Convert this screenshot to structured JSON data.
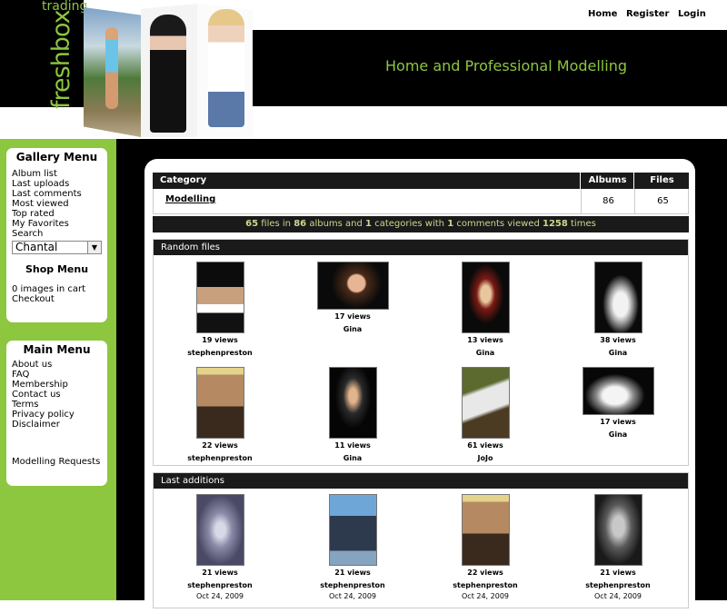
{
  "header": {
    "logo_small": "trading",
    "logo_big": "freshbox",
    "slogan": "Home and Professional Modelling",
    "links": [
      "Home",
      "Register",
      "Login"
    ]
  },
  "gallery_menu": {
    "title": "Gallery Menu",
    "items": [
      "Album list",
      "Last uploads",
      "Last comments",
      "Most viewed",
      "Top rated",
      "My Favorites",
      "Search"
    ],
    "select_value": "Chantal",
    "shop_title": "Shop Menu",
    "shop_items": [
      "0 images in cart",
      "Checkout"
    ]
  },
  "main_menu": {
    "title": "Main Menu",
    "items": [
      "About us",
      "FAQ",
      "Membership",
      "Contact us",
      "Terms",
      "Privacy policy",
      "Disclaimer"
    ],
    "extra": "Modelling Requests"
  },
  "category_table": {
    "headers": [
      "Category",
      "Albums",
      "Files"
    ],
    "row": {
      "name": "Modelling",
      "albums": "86",
      "files": "65"
    },
    "stats": {
      "files": "65",
      "t1": "files in",
      "albums": "86",
      "t2": "albums and",
      "cats": "1",
      "t3": "categories with",
      "comments": "1",
      "t4": "comments viewed",
      "views": "1258",
      "t5": "times"
    }
  },
  "random_files": {
    "title": "Random files",
    "items": [
      {
        "views": "19 views",
        "user": "stephenpreston"
      },
      {
        "views": "17 views",
        "user": "Gina"
      },
      {
        "views": "13 views",
        "user": "Gina"
      },
      {
        "views": "38 views",
        "user": "Gina"
      },
      {
        "views": "22 views",
        "user": "stephenpreston"
      },
      {
        "views": "11 views",
        "user": "Gina"
      },
      {
        "views": "61 views",
        "user": "JoJo"
      },
      {
        "views": "17 views",
        "user": "Gina"
      }
    ]
  },
  "last_additions": {
    "title": "Last additions",
    "items": [
      {
        "views": "21 views",
        "user": "stephenpreston",
        "date": "Oct 24, 2009"
      },
      {
        "views": "21 views",
        "user": "stephenpreston",
        "date": "Oct 24, 2009"
      },
      {
        "views": "22 views",
        "user": "stephenpreston",
        "date": "Oct 24, 2009"
      },
      {
        "views": "21 views",
        "user": "stephenpreston",
        "date": "Oct 24, 2009"
      }
    ]
  },
  "colors": {
    "accent": "#8dc63f",
    "dark": "#1a1a1a",
    "stats_text": "#c8d98e"
  }
}
